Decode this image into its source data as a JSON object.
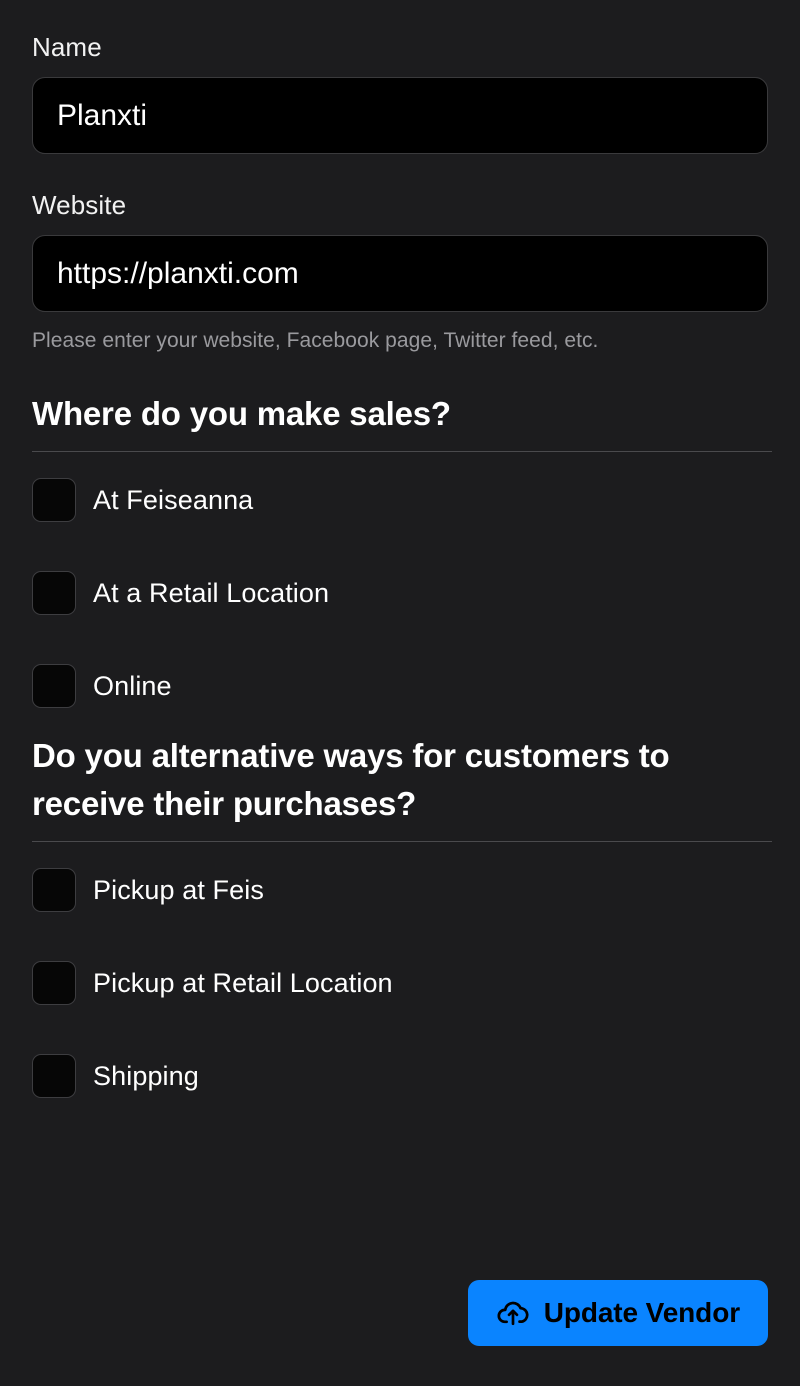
{
  "theme": {
    "background": "#1c1c1e",
    "input_background": "#000000",
    "accent": "#0a84ff",
    "text_primary": "#ffffff",
    "text_muted": "#9a9a9e",
    "divider": "#4a4a4d"
  },
  "form": {
    "name_field": {
      "label": "Name",
      "value": "Planxti",
      "placeholder": "Name"
    },
    "website_field": {
      "label": "Website",
      "value": "https://planxti.com",
      "placeholder": "Website",
      "helper": "Please enter your website, Facebook page, Twitter feed, etc."
    }
  },
  "sections": [
    {
      "heading": "Where do you make sales?",
      "options": [
        {
          "label": "At Feiseanna",
          "checked": false
        },
        {
          "label": "At a Retail Location",
          "checked": false
        },
        {
          "label": "Online",
          "checked": false
        }
      ]
    },
    {
      "heading": "Do you alternative ways for customers to receive their purchases?",
      "options": [
        {
          "label": "Pickup at Feis",
          "checked": false
        },
        {
          "label": "Pickup at Retail Location",
          "checked": false
        },
        {
          "label": "Shipping",
          "checked": false
        }
      ]
    }
  ],
  "footer": {
    "submit_label": "Update Vendor",
    "submit_icon": "cloud-upload-icon"
  }
}
